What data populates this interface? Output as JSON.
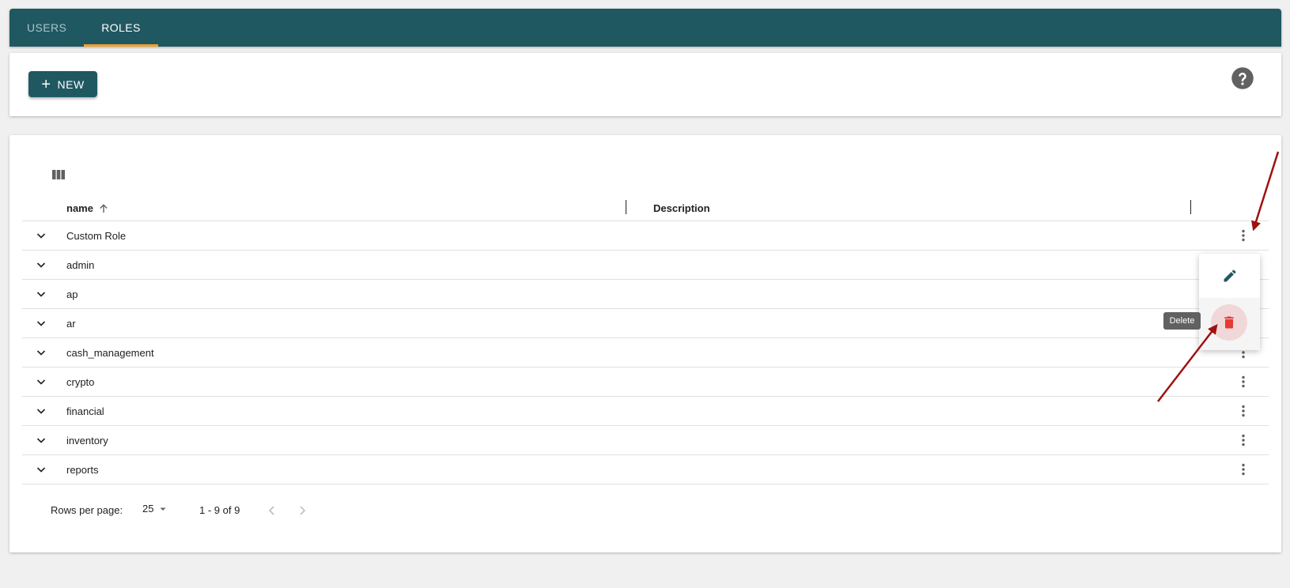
{
  "tabs": [
    {
      "label": "USERS",
      "active": false
    },
    {
      "label": "ROLES",
      "active": true
    }
  ],
  "toolbar": {
    "new_label": "NEW",
    "help_icon": "help-circle-icon"
  },
  "table": {
    "columns_icon": "view-columns-icon",
    "headers": {
      "name": "name",
      "description": "Description"
    },
    "sort": {
      "column": "name",
      "direction": "ascending"
    },
    "rows": [
      {
        "name": "Custom Role",
        "description": ""
      },
      {
        "name": "admin",
        "description": ""
      },
      {
        "name": "ap",
        "description": ""
      },
      {
        "name": "ar",
        "description": ""
      },
      {
        "name": "cash_management",
        "description": ""
      },
      {
        "name": "crypto",
        "description": ""
      },
      {
        "name": "financial",
        "description": ""
      },
      {
        "name": "inventory",
        "description": ""
      },
      {
        "name": "reports",
        "description": ""
      }
    ]
  },
  "pagination": {
    "rows_per_page_label": "Rows per page:",
    "rows_per_page": "25",
    "range": "1 - 9 of 9"
  },
  "row_menu": {
    "edit_icon": "pencil-icon",
    "delete_icon": "trash-icon",
    "delete_tooltip": "Delete"
  },
  "colors": {
    "primary": "#205862",
    "tab_indicator": "#f0a030",
    "danger": "#e53935",
    "annotation_arrow": "#a01010"
  }
}
